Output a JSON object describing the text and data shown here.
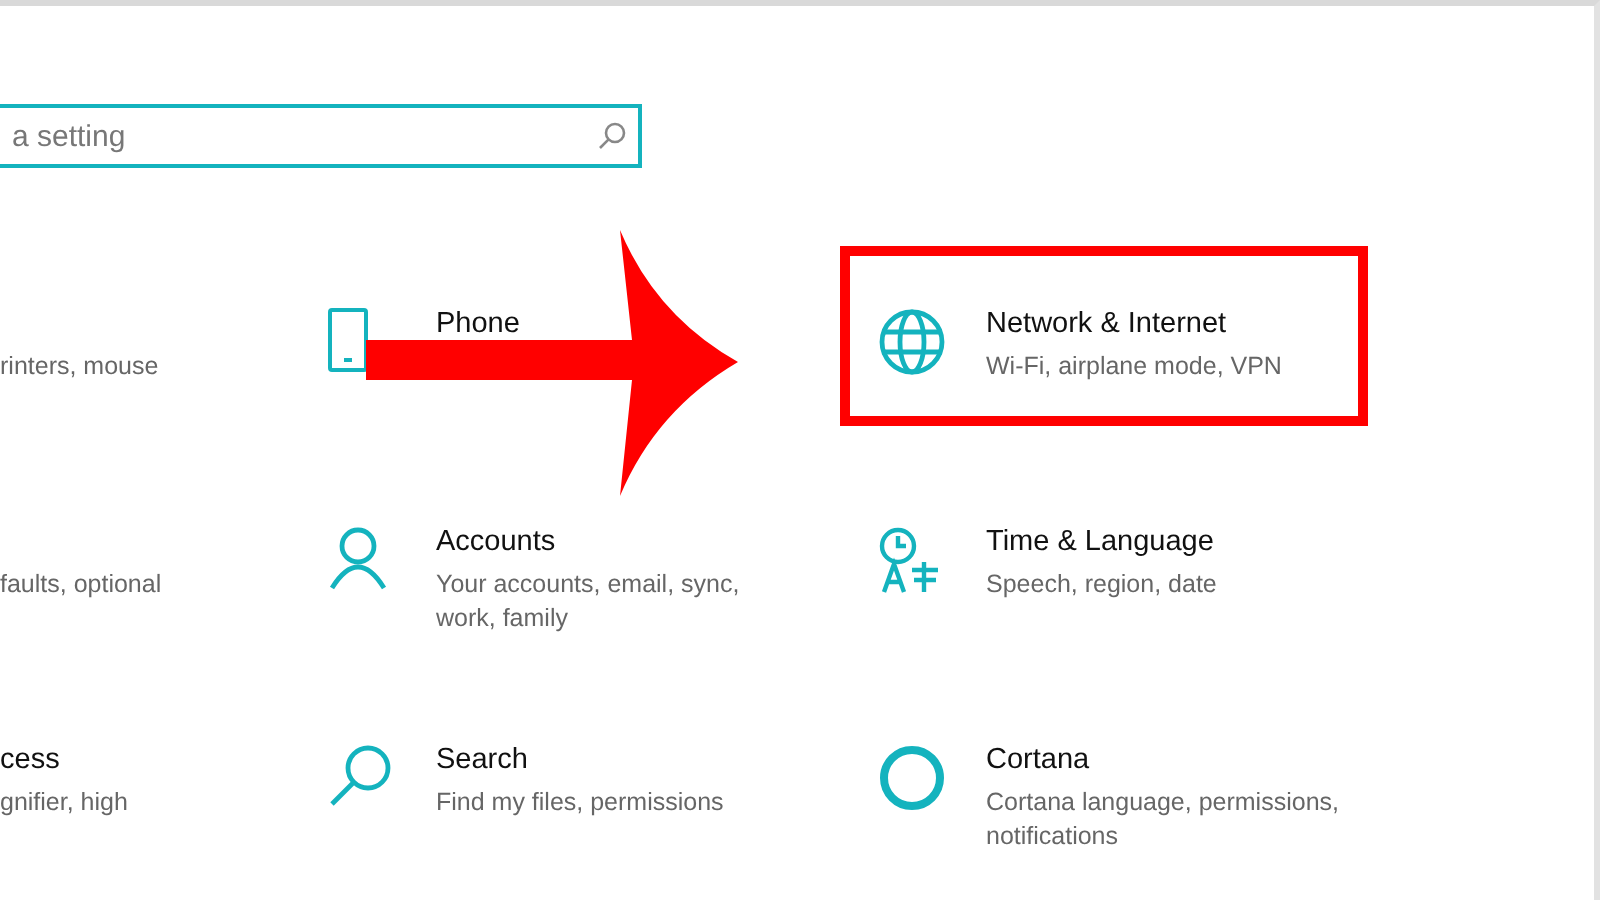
{
  "search": {
    "placeholder": "a setting"
  },
  "categories": [
    {
      "description": "rinters, mouse",
      "highlighted": false
    },
    {
      "title": "Phone",
      "highlighted": false
    },
    {
      "title": "Network & Internet",
      "description": "Wi-Fi, airplane mode, VPN",
      "highlighted": true
    },
    {
      "description": "faults, optional",
      "highlighted": false
    },
    {
      "title": "Accounts",
      "description": "Your accounts, email, sync, work, family",
      "highlighted": false
    },
    {
      "title": "Time & Language",
      "description": "Speech, region, date",
      "highlighted": false
    },
    {
      "title": "cess",
      "description": "gnifier, high",
      "highlighted": false
    },
    {
      "title": "Search",
      "description": "Find my files, permissions",
      "highlighted": false
    },
    {
      "title": "Cortana",
      "description": "Cortana language, permissions, notifications",
      "highlighted": false
    }
  ]
}
